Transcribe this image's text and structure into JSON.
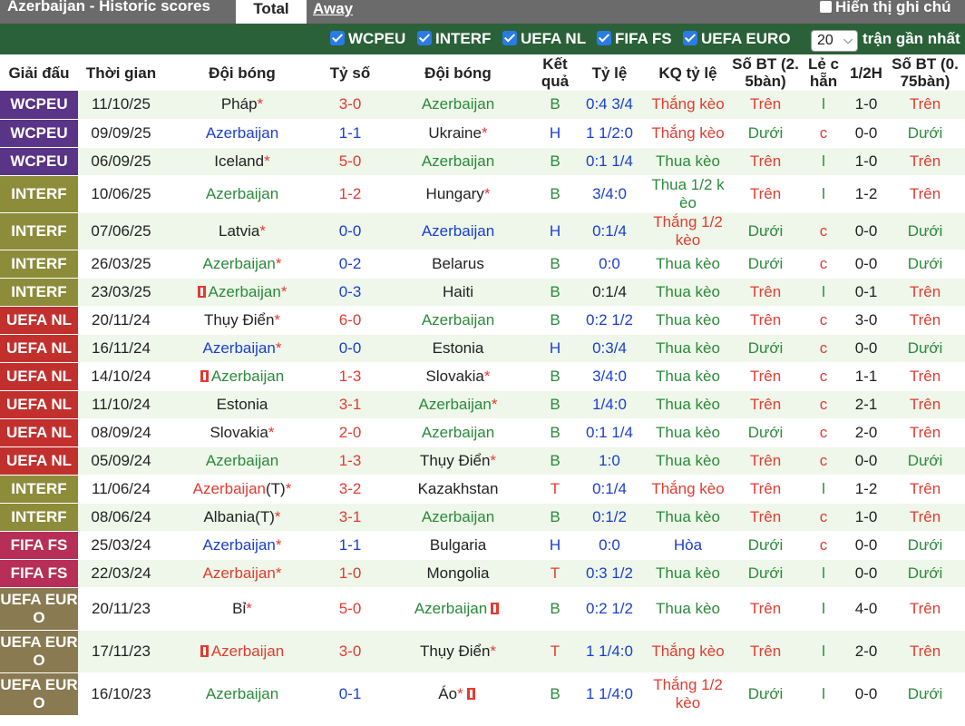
{
  "header": {
    "title": "Azerbaijan - Historic scores",
    "tab_total": "Total",
    "tab_away": "Away",
    "show_notes": "Hiển thị ghi chú"
  },
  "filters": [
    "WCPEU",
    "INTERF",
    "UEFA NL",
    "FIFA FS",
    "UEFA EURO"
  ],
  "count_select": "20",
  "recent_label": "trận gần nhất",
  "columns": [
    "Giải đấu",
    "Thời gian",
    "Đội bóng",
    "Tỷ số",
    "Đội bóng",
    "Kết quả",
    "Tỷ lệ",
    "KQ tỷ lệ",
    "Số BT (2.5bàn)",
    "Lẻ chẵn",
    "1/2H",
    "Số BT (0.75bàn)"
  ],
  "column_display": {
    "ket_qua": [
      "Kết",
      "quả"
    ],
    "bt25": [
      "Số BT (2.",
      "5bàn)"
    ],
    "le_chan": [
      "Lẻ c",
      "hẵn"
    ],
    "bt075": [
      "Số BT (0.",
      "75bàn)"
    ]
  },
  "colors": {
    "win": "#e23b31",
    "lose": "#2a8a3a",
    "draw": "#1a3fd1",
    "header_bg": "#2a6138"
  },
  "rows": [
    {
      "league": "WCPEU",
      "lg": "wcpeu",
      "date": "11/10/25",
      "home": "Pháp",
      "hs": true,
      "hc": "",
      "score": "3-0",
      "sc": "red",
      "away": "Azerbaijan",
      "as": false,
      "ac": "green",
      "res": "B",
      "rc": "green",
      "odds": "0:4 3/4",
      "oc": "blue",
      "oddres": "Thắng kèo",
      "orc": "red",
      "ou": "Trên",
      "ouc": "red",
      "oe": "l",
      "oec": "green",
      "half": "1-0",
      "ou2": "Trên",
      "ou2c": "red"
    },
    {
      "league": "WCPEU",
      "lg": "wcpeu",
      "date": "09/09/25",
      "home": "Azerbaijan",
      "hs": false,
      "hc": "blue",
      "score": "1-1",
      "sc": "blue",
      "away": "Ukraine",
      "as": true,
      "ac": "",
      "res": "H",
      "rc": "blue",
      "odds": "1 1/2:0",
      "oc": "blue",
      "oddres": "Thắng kèo",
      "orc": "red",
      "ou": "Dưới",
      "ouc": "green",
      "oe": "c",
      "oec": "red",
      "half": "0-0",
      "ou2": "Dưới",
      "ou2c": "green"
    },
    {
      "league": "WCPEU",
      "lg": "wcpeu",
      "date": "06/09/25",
      "home": "Iceland",
      "hs": true,
      "hc": "",
      "score": "5-0",
      "sc": "red",
      "away": "Azerbaijan",
      "as": false,
      "ac": "green",
      "res": "B",
      "rc": "green",
      "odds": "0:1 1/4",
      "oc": "blue",
      "oddres": "Thua kèo",
      "orc": "green",
      "ou": "Trên",
      "ouc": "red",
      "oe": "l",
      "oec": "green",
      "half": "1-0",
      "ou2": "Trên",
      "ou2c": "red"
    },
    {
      "league": "INTERF",
      "lg": "interf",
      "date": "10/06/25",
      "home": "Azerbaijan",
      "hs": false,
      "hc": "green",
      "score": "1-2",
      "sc": "red",
      "away": "Hungary",
      "as": true,
      "ac": "",
      "res": "B",
      "rc": "green",
      "odds": "3/4:0",
      "oc": "blue",
      "oddres": "Thua 1/2 kèo",
      "orc": "green",
      "ou": "Trên",
      "ouc": "red",
      "oe": "l",
      "oec": "green",
      "half": "1-2",
      "ou2": "Trên",
      "ou2c": "red",
      "tall": true,
      "oddres_lines": [
        "Thua 1/2 k",
        "èo"
      ]
    },
    {
      "league": "INTERF",
      "lg": "interf",
      "date": "07/06/25",
      "home": "Latvia",
      "hs": true,
      "hc": "",
      "score": "0-0",
      "sc": "blue",
      "away": "Azerbaijan",
      "as": false,
      "ac": "blue",
      "res": "H",
      "rc": "blue",
      "odds": "0:1/4",
      "oc": "blue",
      "oddres": "Thắng 1/2 kèo",
      "orc": "red",
      "ou": "Dưới",
      "ouc": "green",
      "oe": "c",
      "oec": "red",
      "half": "0-0",
      "ou2": "Dưới",
      "ou2c": "green",
      "tall": true,
      "oddres_lines": [
        "Thắng 1/2",
        "kèo"
      ]
    },
    {
      "league": "INTERF",
      "lg": "interf",
      "date": "26/03/25",
      "home": "Azerbaijan",
      "hs": true,
      "hc": "green",
      "score": "0-2",
      "sc": "blue",
      "away": "Belarus",
      "as": false,
      "ac": "",
      "res": "B",
      "rc": "green",
      "odds": "0:0",
      "oc": "blue",
      "oddres": "Thua kèo",
      "orc": "green",
      "ou": "Dưới",
      "ouc": "green",
      "oe": "c",
      "oec": "red",
      "half": "0-0",
      "ou2": "Dưới",
      "ou2c": "green"
    },
    {
      "league": "INTERF",
      "lg": "interf",
      "date": "23/03/25",
      "home": "Azerbaijan",
      "hs": true,
      "hc": "green",
      "hflag": true,
      "score": "0-3",
      "sc": "blue",
      "away": "Haiti",
      "as": false,
      "ac": "",
      "res": "B",
      "rc": "green",
      "odds": "0:1/4",
      "oc": "",
      "oddres": "Thua kèo",
      "orc": "green",
      "ou": "Trên",
      "ouc": "red",
      "oe": "l",
      "oec": "green",
      "half": "0-1",
      "ou2": "Trên",
      "ou2c": "red"
    },
    {
      "league": "UEFA NL",
      "lg": "nl",
      "date": "20/11/24",
      "home": "Thụy Điển",
      "hs": true,
      "hc": "",
      "score": "6-0",
      "sc": "red",
      "away": "Azerbaijan",
      "as": false,
      "ac": "green",
      "res": "B",
      "rc": "green",
      "odds": "0:2 1/2",
      "oc": "blue",
      "oddres": "Thua kèo",
      "orc": "green",
      "ou": "Trên",
      "ouc": "red",
      "oe": "c",
      "oec": "red",
      "half": "3-0",
      "ou2": "Trên",
      "ou2c": "red"
    },
    {
      "league": "UEFA NL",
      "lg": "nl",
      "date": "16/11/24",
      "home": "Azerbaijan",
      "hs": true,
      "hc": "blue",
      "score": "0-0",
      "sc": "blue",
      "away": "Estonia",
      "as": false,
      "ac": "",
      "res": "H",
      "rc": "blue",
      "odds": "0:3/4",
      "oc": "blue",
      "oddres": "Thua kèo",
      "orc": "green",
      "ou": "Dưới",
      "ouc": "green",
      "oe": "c",
      "oec": "red",
      "half": "0-0",
      "ou2": "Dưới",
      "ou2c": "green"
    },
    {
      "league": "UEFA NL",
      "lg": "nl",
      "date": "14/10/24",
      "home": "Azerbaijan",
      "hs": false,
      "hc": "green",
      "hflag": true,
      "score": "1-3",
      "sc": "red",
      "away": "Slovakia",
      "as": true,
      "ac": "",
      "res": "B",
      "rc": "green",
      "odds": "3/4:0",
      "oc": "blue",
      "oddres": "Thua kèo",
      "orc": "green",
      "ou": "Trên",
      "ouc": "red",
      "oe": "c",
      "oec": "red",
      "half": "1-1",
      "ou2": "Trên",
      "ou2c": "red"
    },
    {
      "league": "UEFA NL",
      "lg": "nl",
      "date": "11/10/24",
      "home": "Estonia",
      "hs": false,
      "hc": "",
      "score": "3-1",
      "sc": "red",
      "away": "Azerbaijan",
      "as": true,
      "ac": "green",
      "res": "B",
      "rc": "green",
      "odds": "1/4:0",
      "oc": "blue",
      "oddres": "Thua kèo",
      "orc": "green",
      "ou": "Trên",
      "ouc": "red",
      "oe": "c",
      "oec": "red",
      "half": "2-1",
      "ou2": "Trên",
      "ou2c": "red"
    },
    {
      "league": "UEFA NL",
      "lg": "nl",
      "date": "08/09/24",
      "home": "Slovakia",
      "hs": true,
      "hc": "",
      "score": "2-0",
      "sc": "red",
      "away": "Azerbaijan",
      "as": false,
      "ac": "green",
      "res": "B",
      "rc": "green",
      "odds": "0:1 1/4",
      "oc": "blue",
      "oddres": "Thua kèo",
      "orc": "green",
      "ou": "Dưới",
      "ouc": "green",
      "oe": "c",
      "oec": "red",
      "half": "2-0",
      "ou2": "Trên",
      "ou2c": "red"
    },
    {
      "league": "UEFA NL",
      "lg": "nl",
      "date": "05/09/24",
      "home": "Azerbaijan",
      "hs": false,
      "hc": "green",
      "score": "1-3",
      "sc": "red",
      "away": "Thụy Điển",
      "as": true,
      "ac": "",
      "res": "B",
      "rc": "green",
      "odds": "1:0",
      "oc": "blue",
      "oddres": "Thua kèo",
      "orc": "green",
      "ou": "Trên",
      "ouc": "red",
      "oe": "c",
      "oec": "red",
      "half": "0-0",
      "ou2": "Dưới",
      "ou2c": "green"
    },
    {
      "league": "INTERF",
      "lg": "interf",
      "date": "11/06/24",
      "home": "Azerbaijan(T)",
      "hs": true,
      "hc": "red",
      "hcsplit": true,
      "score": "3-2",
      "sc": "red",
      "away": "Kazakhstan",
      "as": false,
      "ac": "",
      "res": "T",
      "rc": "red",
      "odds": "0:1/4",
      "oc": "blue",
      "oddres": "Thắng kèo",
      "orc": "red",
      "ou": "Trên",
      "ouc": "red",
      "oe": "l",
      "oec": "green",
      "half": "1-2",
      "ou2": "Trên",
      "ou2c": "red"
    },
    {
      "league": "INTERF",
      "lg": "interf",
      "date": "08/06/24",
      "home": "Albania(T)",
      "hs": true,
      "hc": "",
      "score": "3-1",
      "sc": "red",
      "away": "Azerbaijan",
      "as": false,
      "ac": "green",
      "res": "B",
      "rc": "green",
      "odds": "0:1/2",
      "oc": "blue",
      "oddres": "Thua kèo",
      "orc": "green",
      "ou": "Trên",
      "ouc": "red",
      "oe": "c",
      "oec": "red",
      "half": "1-0",
      "ou2": "Trên",
      "ou2c": "red"
    },
    {
      "league": "FIFA FS",
      "lg": "fifa",
      "date": "25/03/24",
      "home": "Azerbaijan",
      "hs": true,
      "hc": "blue",
      "score": "1-1",
      "sc": "blue",
      "away": "Bulgaria",
      "as": false,
      "ac": "",
      "res": "H",
      "rc": "blue",
      "odds": "0:0",
      "oc": "blue",
      "oddres": "Hòa",
      "orc": "blue",
      "ou": "Dưới",
      "ouc": "green",
      "oe": "c",
      "oec": "red",
      "half": "0-0",
      "ou2": "Dưới",
      "ou2c": "green"
    },
    {
      "league": "FIFA FS",
      "lg": "fifa",
      "date": "22/03/24",
      "home": "Azerbaijan",
      "hs": true,
      "hc": "red",
      "score": "1-0",
      "sc": "red",
      "away": "Mongolia",
      "as": false,
      "ac": "",
      "res": "T",
      "rc": "red",
      "odds": "0:3 1/2",
      "oc": "blue",
      "oddres": "Thua kèo",
      "orc": "green",
      "ou": "Dưới",
      "ouc": "green",
      "oe": "l",
      "oec": "green",
      "half": "0-0",
      "ou2": "Dưới",
      "ou2c": "green"
    },
    {
      "league": "UEFA EURO",
      "lg": "euro",
      "date": "20/11/23",
      "home": "Bỉ",
      "hs": true,
      "hc": "",
      "score": "5-0",
      "sc": "red",
      "away": "Azerbaijan",
      "as": false,
      "ac": "green",
      "aflag": true,
      "res": "B",
      "rc": "green",
      "odds": "0:2 1/2",
      "oc": "blue",
      "oddres": "Thua kèo",
      "orc": "green",
      "ou": "Trên",
      "ouc": "red",
      "oe": "l",
      "oec": "green",
      "half": "4-0",
      "ou2": "Trên",
      "ou2c": "red",
      "league_lines": [
        "UEFA EUR",
        "O"
      ],
      "euro": true
    },
    {
      "league": "UEFA EURO",
      "lg": "euro",
      "date": "17/11/23",
      "home": "Azerbaijan",
      "hs": false,
      "hc": "red",
      "hflag": true,
      "score": "3-0",
      "sc": "red",
      "away": "Thụy Điển",
      "as": true,
      "ac": "",
      "res": "T",
      "rc": "red",
      "odds": "1 1/4:0",
      "oc": "blue",
      "oddres": "Thắng kèo",
      "orc": "red",
      "ou": "Trên",
      "ouc": "red",
      "oe": "l",
      "oec": "green",
      "half": "2-0",
      "ou2": "Trên",
      "ou2c": "red",
      "league_lines": [
        "UEFA EUR",
        "O"
      ],
      "euro": true
    },
    {
      "league": "UEFA EURO",
      "lg": "euro",
      "date": "16/10/23",
      "home": "Azerbaijan",
      "hs": false,
      "hc": "green",
      "score": "0-1",
      "sc": "blue",
      "away": "Áo",
      "as": true,
      "ac": "",
      "aflag": true,
      "res": "B",
      "rc": "green",
      "odds": "1 1/4:0",
      "oc": "blue",
      "oddres": "Thắng 1/2 kèo",
      "orc": "red",
      "ou": "Dưới",
      "ouc": "green",
      "oe": "l",
      "oec": "green",
      "half": "0-0",
      "ou2": "Dưới",
      "ou2c": "green",
      "league_lines": [
        "UEFA EUR",
        "O"
      ],
      "euro": true,
      "oddres_lines": [
        "Thắng 1/2",
        "kèo"
      ]
    }
  ]
}
